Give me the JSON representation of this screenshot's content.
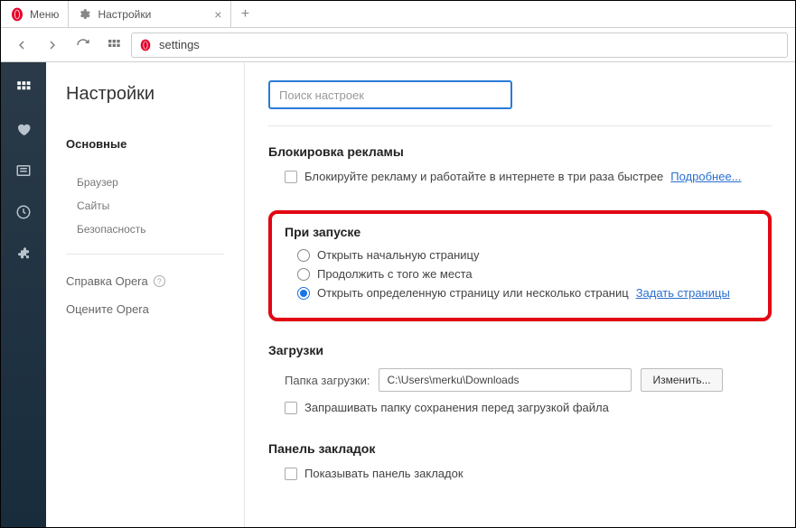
{
  "titlebar": {
    "menu_label": "Меню",
    "tab_title": "Настройки"
  },
  "toolbar": {
    "url_text": "settings"
  },
  "sidebar": {
    "heading": "Настройки",
    "items": {
      "basic": "Основные",
      "browser": "Браузер",
      "sites": "Сайты",
      "security": "Безопасность",
      "help": "Справка Opera",
      "rate": "Оцените Opera"
    }
  },
  "content": {
    "search_placeholder": "Поиск настроек",
    "adblock": {
      "title": "Блокировка рекламы",
      "check_label": "Блокируйте рекламу и работайте в интернете в три раза быстрее",
      "more": "Подробнее..."
    },
    "startup": {
      "title": "При запуске",
      "opt1": "Открыть начальную страницу",
      "opt2": "Продолжить с того же места",
      "opt3": "Открыть определенную страницу или несколько страниц",
      "set_pages": "Задать страницы"
    },
    "downloads": {
      "title": "Загрузки",
      "folder_label": "Папка загрузки:",
      "folder_value": "C:\\Users\\merku\\Downloads",
      "change_btn": "Изменить...",
      "ask_label": "Запрашивать папку сохранения перед загрузкой файла"
    },
    "bookmarks": {
      "title": "Панель закладок",
      "show_label": "Показывать панель закладок"
    }
  }
}
